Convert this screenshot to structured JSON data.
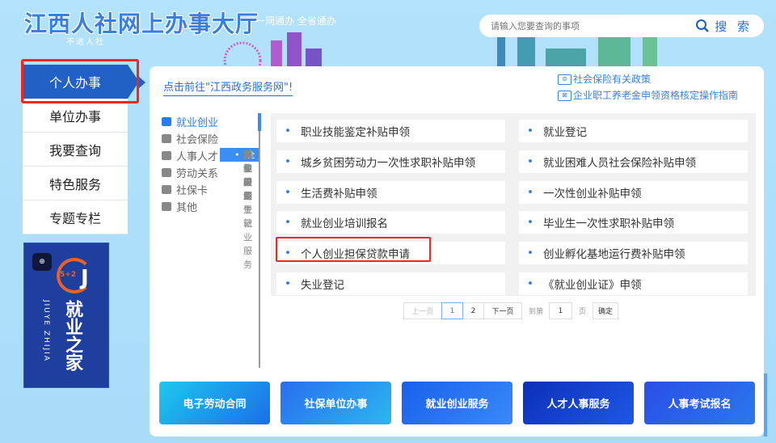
{
  "header": {
    "title": "江西人社网上办事大厅",
    "slogan": "一网通办 全省通办",
    "subtitle": "不进人社",
    "search_placeholder": "请输入您要查询的事项",
    "search_label": "搜 索"
  },
  "nav": {
    "items": [
      "个人办事",
      "单位办事",
      "我要查询",
      "特色服务",
      "专题专栏"
    ],
    "active": 0
  },
  "banner": {
    "badge": "⊕",
    "number": "5+2",
    "letter": "J",
    "en": "JIUYE ZHIJIA",
    "zh": "就业之家"
  },
  "main": {
    "top_link": "点击前往\"江西政务服务网\"!",
    "policy_links": [
      {
        "icon": "⊜",
        "label": "社会保险有关政策"
      },
      {
        "icon": "⊠",
        "label": "企业职工养老金申领资格核定操作指南"
      }
    ],
    "tree": {
      "cat0": "就业创业",
      "subs": [
        "全部",
        "职业介绍",
        "就业失业登记",
        "创业服务",
        "就业援助",
        "高校毕业生就业服务",
        "职业培训",
        "档案服务",
        "其他"
      ],
      "cats": [
        "社会保险",
        "人事人才",
        "劳动关系",
        "社保卡",
        "其他"
      ]
    },
    "services": [
      "职业技能鉴定补贴申领",
      "就业登记",
      "城乡贫困劳动力一次性求职补贴申领",
      "就业困难人员社会保险补贴申领",
      "生活费补贴申领",
      "一次性创业补贴申领",
      "就业创业培训报名",
      "毕业生一次性求职补贴申领",
      "个人创业担保贷款申请",
      "创业孵化基地运行费补贴申领",
      "失业登记",
      "《就业创业证》申领"
    ],
    "pager": {
      "prev": "上一页",
      "pages": [
        "1",
        "2"
      ],
      "current": "1",
      "next": "下一页",
      "goto_label": "到第",
      "goto_value": "1",
      "page_unit": "页",
      "confirm": "确定"
    },
    "cards": [
      "电子劳动合同",
      "社保单位办事",
      "就业创业服务",
      "人才人事服务",
      "人事考试报名"
    ]
  },
  "colors": {
    "accent": "#2160c4",
    "highlight": "#f2271c",
    "link": "#2a6fd6"
  }
}
